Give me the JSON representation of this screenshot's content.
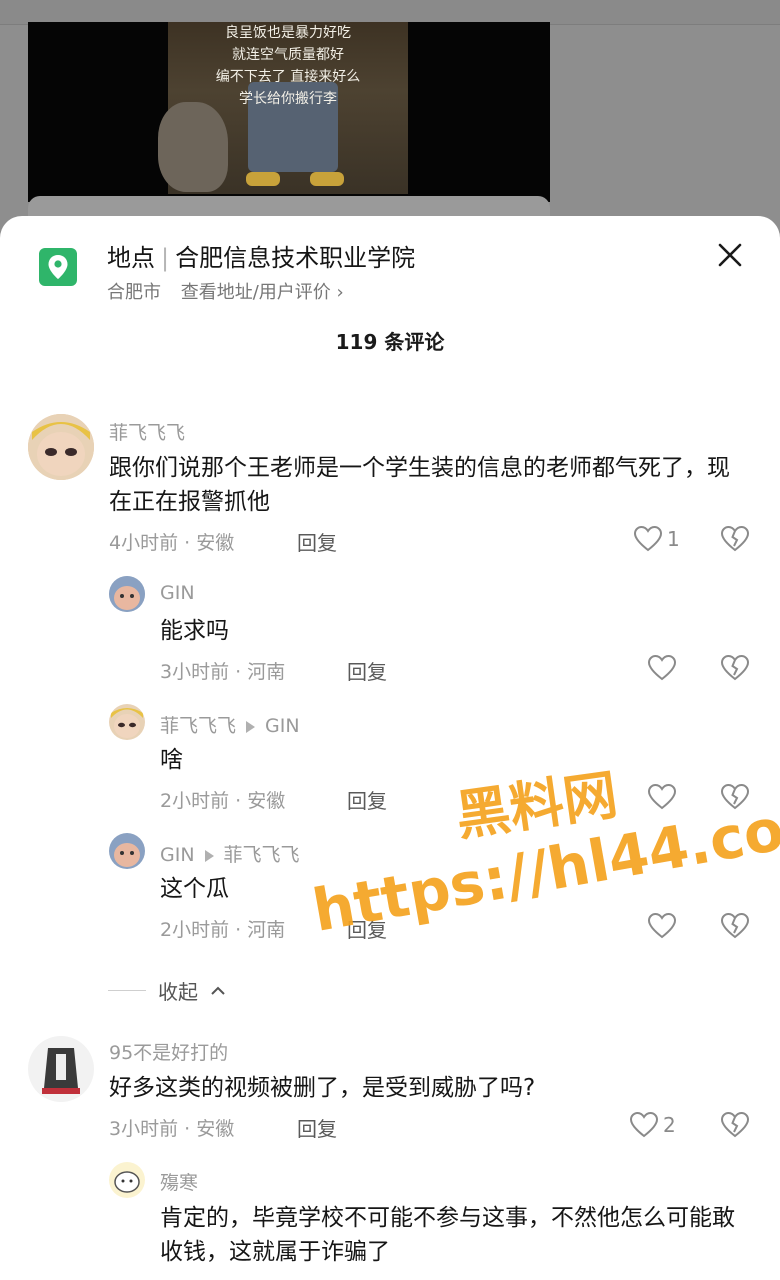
{
  "video": {
    "subtitles": [
      "良呈饭也是暴力好吃",
      "就连空气质量都好",
      "编不下去了 直接来好么",
      "学长给你搬行李"
    ]
  },
  "location": {
    "label": "地点",
    "name": "合肥信息技术职业学院",
    "city": "合肥市",
    "link": "查看地址/用户评价",
    "link_chevron": "›"
  },
  "comments_count": "119 条评论",
  "comments": [
    {
      "user": "菲飞飞飞",
      "text": "跟你们说那个王老师是一个学生装的信息的老师都气死了，现在正在报警抓他",
      "meta": "4小时前 · 安徽",
      "reply": "回复",
      "likes": "1"
    },
    {
      "user": "GIN",
      "text": "能求吗",
      "meta": "3小时前 · 河南",
      "reply": "回复",
      "likes": ""
    },
    {
      "user": "菲飞飞飞",
      "to": "GIN",
      "text": "啥",
      "meta": "2小时前 · 安徽",
      "reply": "回复",
      "likes": ""
    },
    {
      "user": "GIN",
      "to": "菲飞飞飞",
      "text": "这个瓜",
      "meta": "2小时前 · 河南",
      "reply": "回复",
      "likes": ""
    },
    {
      "user": "95不是好打的",
      "text": "好多这类的视频被删了，是受到威胁了吗?",
      "meta": "3小时前 · 安徽",
      "reply": "回复",
      "likes": "2"
    },
    {
      "user": "殤寒",
      "text": "肯定的，毕竟学校不可能不参与这事，不然他怎么可能敢收钱，这就属于诈骗了",
      "meta": "",
      "reply": "",
      "likes": ""
    }
  ],
  "collapse_label": "收起",
  "watermark": {
    "line1": "黑料网",
    "line2": "https://hl44.co"
  },
  "colors": {
    "location_icon": "#2fb56a",
    "watermark": "#f5a320"
  }
}
